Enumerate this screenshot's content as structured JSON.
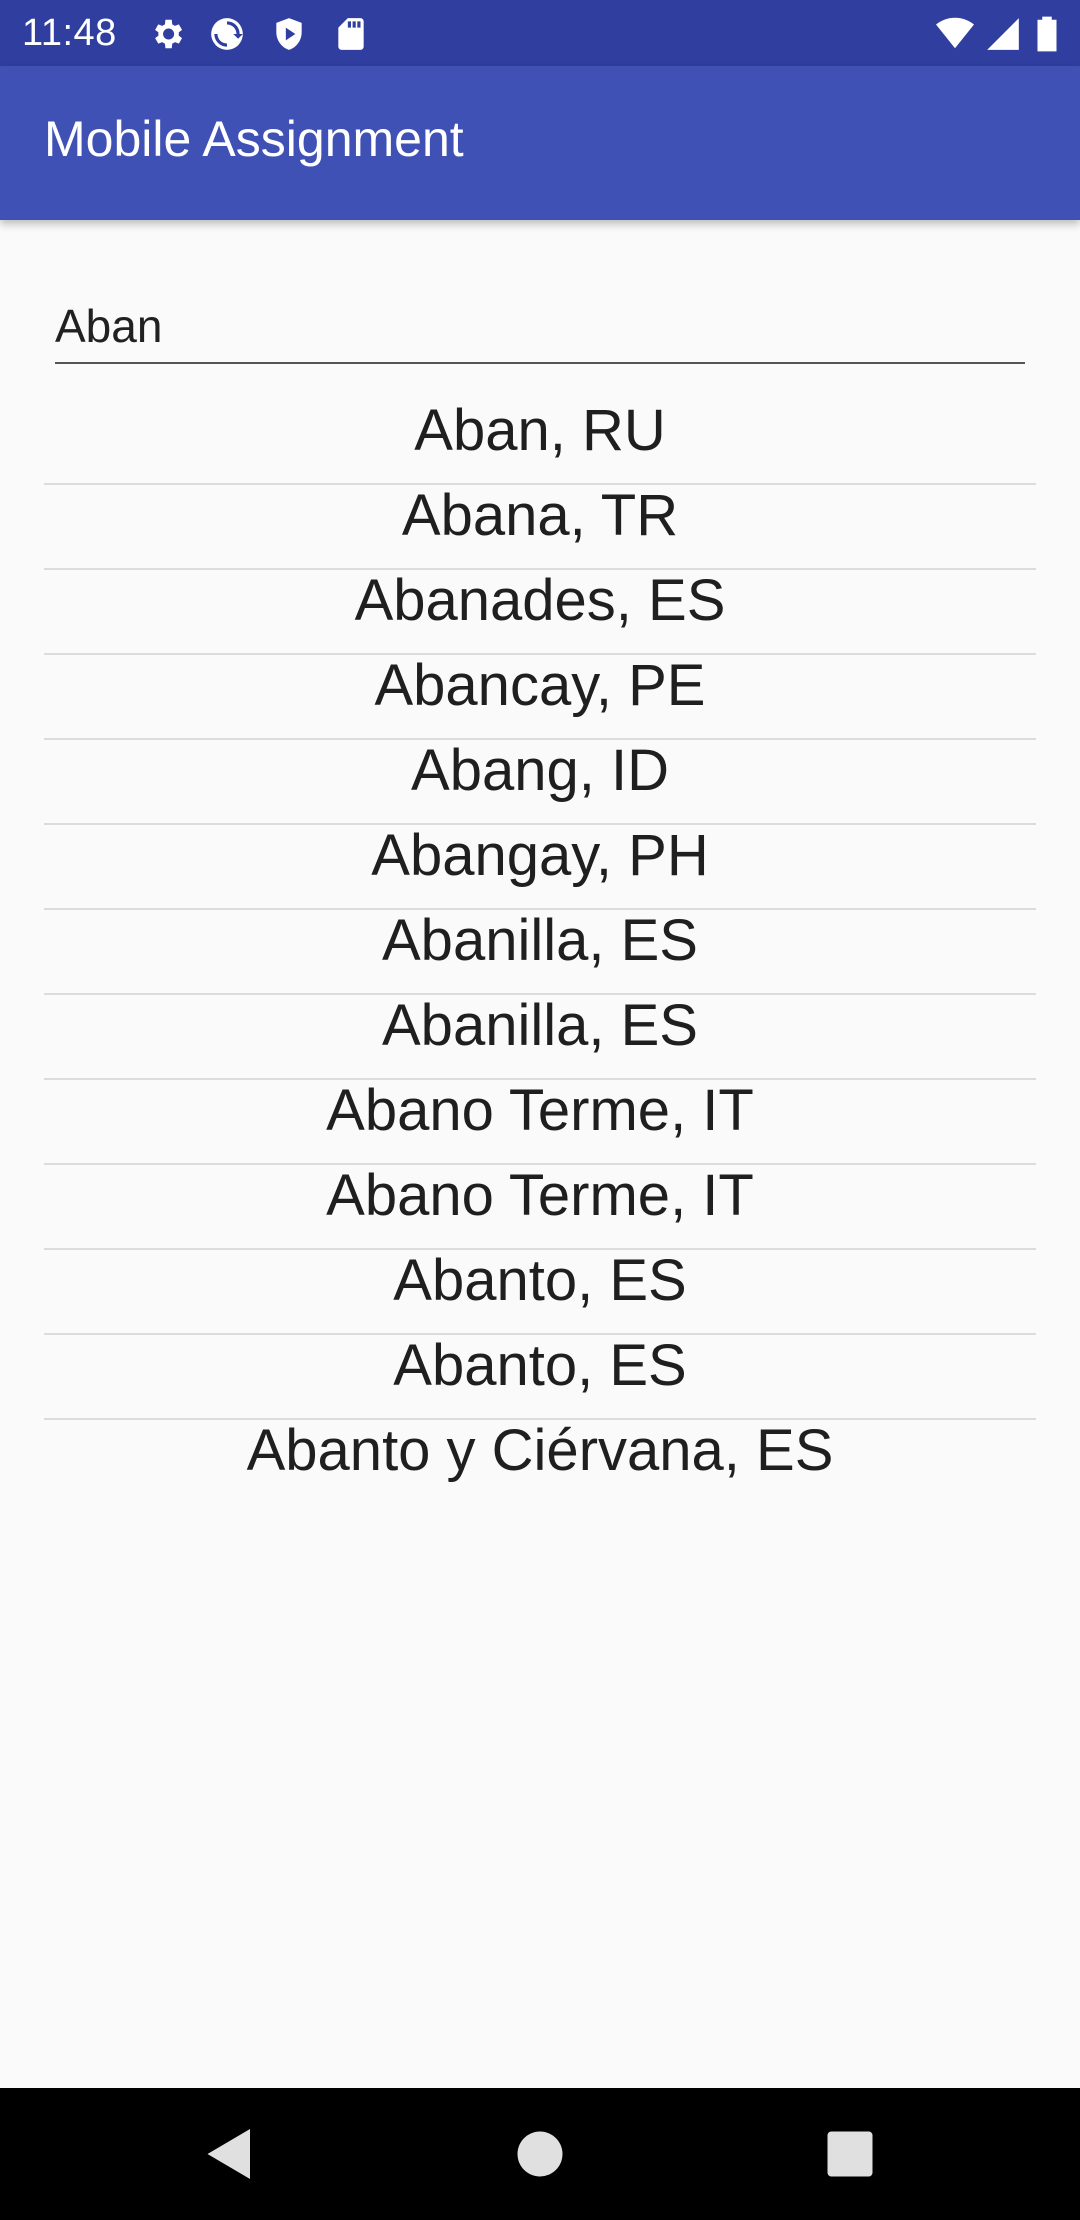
{
  "status_bar": {
    "time": "11:48",
    "icons_left": [
      "gear-icon",
      "sync-icon",
      "shield-icon",
      "sd-card-icon"
    ],
    "icons_right": [
      "wifi-icon",
      "signal-icon",
      "battery-icon"
    ]
  },
  "app_bar": {
    "title": "Mobile Assignment"
  },
  "search": {
    "value": "Aban"
  },
  "results": [
    "Aban, RU",
    "Abana, TR",
    "Abanades, ES",
    "Abancay, PE",
    "Abang, ID",
    "Abangay, PH",
    "Abanilla, ES",
    "Abanilla, ES",
    "Abano Terme, IT",
    "Abano Terme, IT",
    "Abanto, ES",
    "Abanto, ES",
    "Abanto y Ciérvana, ES"
  ],
  "nav_bar": {
    "buttons": [
      "back-icon",
      "home-icon",
      "recents-icon"
    ]
  },
  "colors": {
    "status_bar": "#303f9f",
    "app_bar": "#3f51b5",
    "background": "#fafafa",
    "nav_bar": "#000000"
  }
}
